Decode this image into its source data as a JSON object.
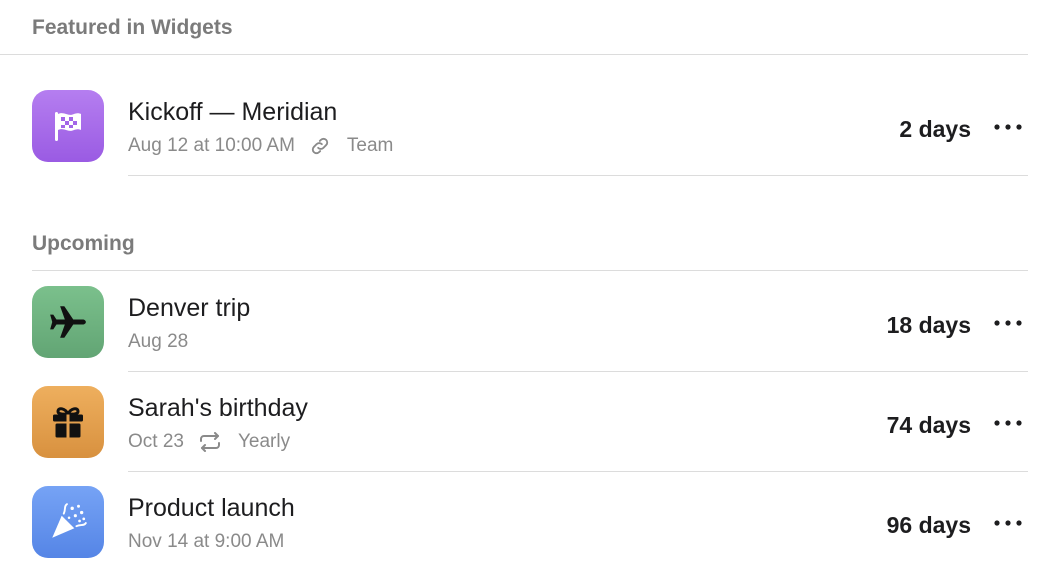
{
  "sections": {
    "featured": {
      "header": "Featured in Widgets",
      "item": {
        "title": "Kickoff — Meridian",
        "date": "Aug 12 at 10:00 AM",
        "meta_icon": "link-icon",
        "meta": "Team",
        "countdown": "2 days",
        "icon": "checkered-flag-icon",
        "color": "#a366e8"
      }
    },
    "upcoming": {
      "header": "Upcoming",
      "items": [
        {
          "title": "Denver trip",
          "date": "Aug 28",
          "countdown": "18 days",
          "icon": "airplane-icon",
          "color": "#6cb07e"
        },
        {
          "title": "Sarah's birthday",
          "date": "Oct 23",
          "meta_icon": "repeat-icon",
          "meta": "Yearly",
          "countdown": "74 days",
          "icon": "gift-icon",
          "color": "#e3a04f"
        },
        {
          "title": "Product launch",
          "date": "Nov 14 at 9:00 AM",
          "countdown": "96 days",
          "icon": "party-popper-icon",
          "color": "#5f8fee"
        }
      ]
    }
  }
}
